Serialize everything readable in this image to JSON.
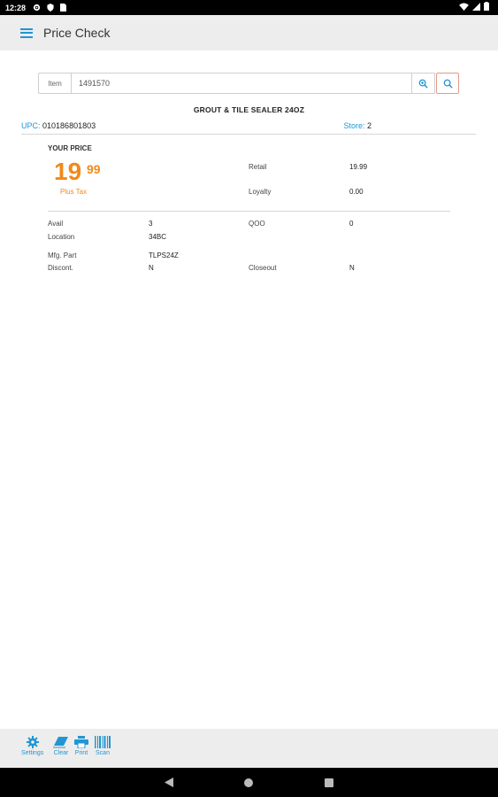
{
  "status": {
    "time": "12:28"
  },
  "appbar": {
    "title": "Price Check"
  },
  "search": {
    "item_label": "Item",
    "item_value": "1491570"
  },
  "product": {
    "name": "GROUT & TILE SEALER 24OZ",
    "upc_label": "UPC:",
    "upc_value": "010186801803",
    "store_label": "Store:",
    "store_value": "2"
  },
  "pricing": {
    "your_price_label": "YOUR PRICE",
    "price_whole": "19",
    "price_cents": "99",
    "plus_tax": "Plus Tax",
    "retail_label": "Retail",
    "retail_value": "19.99",
    "loyalty_label": "Loyalty",
    "loyalty_value": "0.00"
  },
  "details": {
    "avail_label": "Avail",
    "avail_value": "3",
    "qoo_label": "QOO",
    "qoo_value": "0",
    "location_label": "Location",
    "location_value": "34BC",
    "mfg_part_label": "Mfg. Part",
    "mfg_part_value": "TLPS24Z",
    "discont_label": "Discont.",
    "discont_value": "N",
    "closeout_label": "Closeout",
    "closeout_value": "N"
  },
  "toolbar": {
    "settings": "Settings",
    "clear": "Clear",
    "print": "Print",
    "scan": "Scan"
  },
  "colors": {
    "accent": "#2196d3",
    "price": "#f08a1a"
  },
  "icons": [
    "gear-icon",
    "eraser-icon",
    "printer-icon",
    "barcode-icon",
    "zoom-in-icon",
    "search-icon",
    "menu-icon"
  ]
}
